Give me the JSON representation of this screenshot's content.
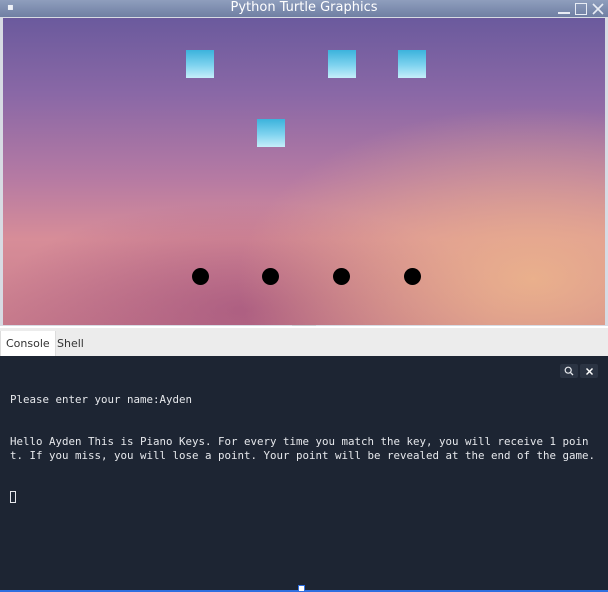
{
  "window": {
    "title": "Python Turtle Graphics",
    "menu_glyph": "▪"
  },
  "game": {
    "key_tile_color": "#5cc6ea",
    "dot_color": "#000000",
    "key_tiles_count": 4,
    "dots_count": 4
  },
  "panel": {
    "tabs": [
      {
        "label": "Console",
        "active": true
      },
      {
        "label": "Shell",
        "active": false
      }
    ]
  },
  "console": {
    "lines": [
      "Please enter your name:Ayden",
      "Hello Ayden This is Piano Keys. For every time you match the key, you will receive 1 point. If you miss, you will lose a point. Your point will be revealed at the end of the game."
    ],
    "search_icon": "search-icon",
    "close_icon": "close-icon",
    "background_color": "#1d2533"
  }
}
